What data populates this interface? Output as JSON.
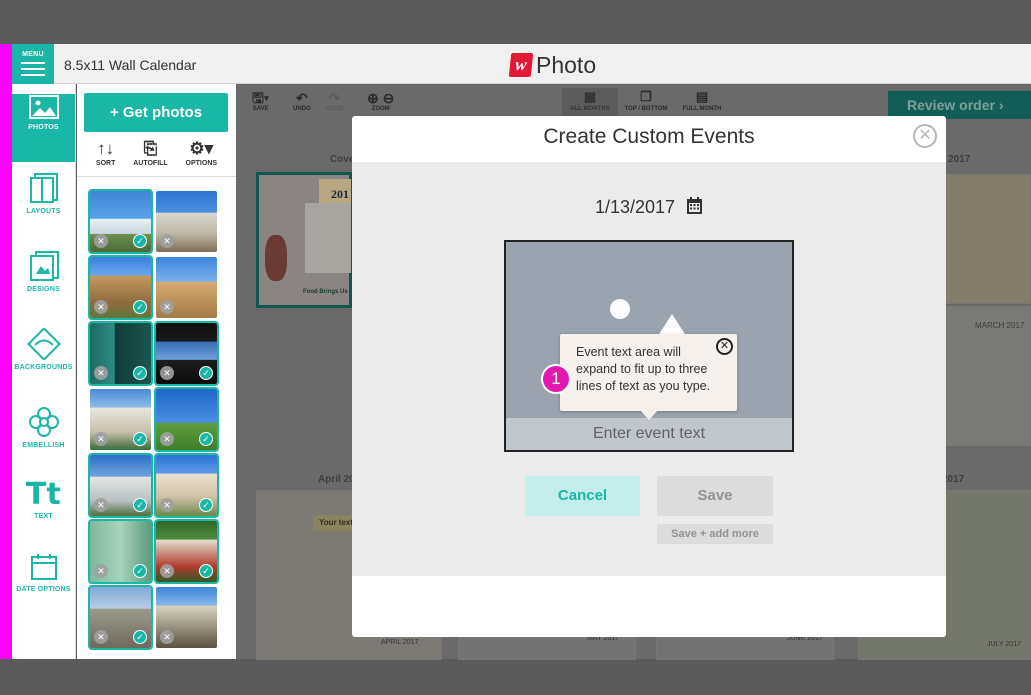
{
  "header": {
    "menu_label": "MENU",
    "title": "8.5x11 Wall Calendar",
    "logo_mark": "w",
    "logo_text": "Photo"
  },
  "leftnav": {
    "items": [
      {
        "label": "PHOTOS",
        "icon": "photo-icon",
        "active": true
      },
      {
        "label": "LAYOUTS",
        "icon": "layouts-icon"
      },
      {
        "label": "DESIGNS",
        "icon": "designs-icon"
      },
      {
        "label": "BACKGROUNDS",
        "icon": "backgrounds-icon"
      },
      {
        "label": "EMBELLISH",
        "icon": "flower-icon"
      },
      {
        "label": "TEXT",
        "icon": "text-icon",
        "glyph": "Tt"
      },
      {
        "label": "DATE OPTIONS",
        "icon": "calendar-icon"
      }
    ]
  },
  "photo_panel": {
    "get_photos_label": "+ Get photos",
    "tools": [
      {
        "label": "SORT",
        "glyph": "↑↓"
      },
      {
        "label": "AUTOFILL",
        "glyph": "⎘"
      },
      {
        "label": "OPTIONS",
        "glyph": "⚙▾"
      }
    ]
  },
  "toolbar": {
    "save_label": "SAVE",
    "undo_label": "UNDO",
    "redo_label": "REDO",
    "zoom_label": "ZOOM",
    "views": [
      "ALL MONTHS",
      "TOP / BOTTOM",
      "FULL MONTH"
    ],
    "review_label": "Review order ›"
  },
  "pages": {
    "cover_label": "Cove",
    "march_label": "2017",
    "april_label": "April 20",
    "right_label": "2017",
    "march_title": "MARCH 2017",
    "cover_year": "201",
    "cover_caption": "Food Brings Us",
    "april_tag": "Your text",
    "months": [
      "APRIL 2017",
      "MAY 2017",
      "JUNE 2017",
      "JULY 2017"
    ]
  },
  "modal": {
    "title": "Create Custom Events",
    "date": "1/13/2017",
    "event_placeholder": "Enter event text",
    "tooltip_text": "Event text area will expand to fit up to three lines of text as you type.",
    "step_number": "1",
    "cancel_label": "Cancel",
    "save_label": "Save",
    "save_more_label": "Save + add more"
  },
  "colors": {
    "accent": "#1ab7a6",
    "brand_red": "#e31837",
    "step_badge": "#e01ab0",
    "side_bar": "#ff00ff"
  }
}
